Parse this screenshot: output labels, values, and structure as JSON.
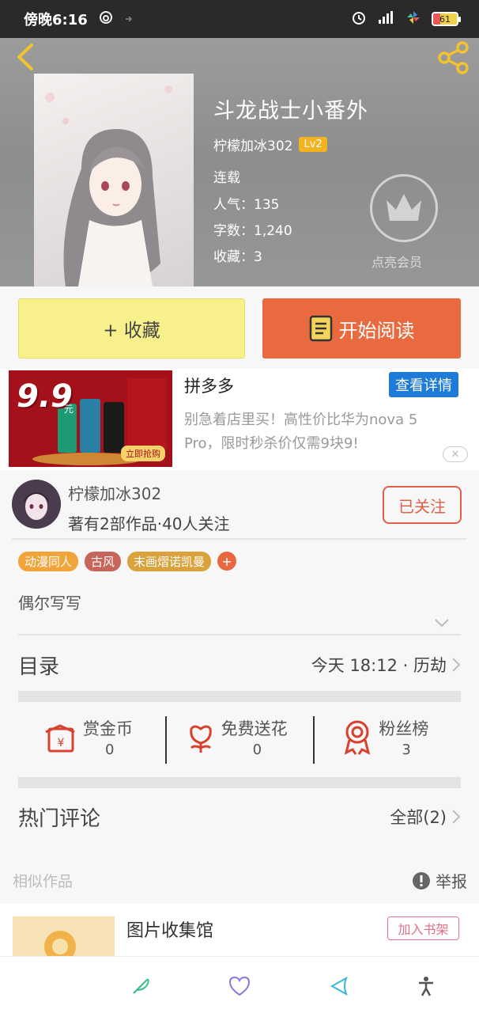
{
  "status_bar": {
    "time": "傍晚6:16",
    "battery": "61"
  },
  "book": {
    "title": "斗龙战士小番外",
    "author": "柠檬加冰302",
    "level": "Lv2",
    "status": "连载",
    "popularity": "人气：135",
    "word_count": "字数：1,240",
    "favorites": "收藏：3",
    "vip_label": "点亮会员"
  },
  "actions": {
    "favorite_label": "+ 收藏",
    "read_label": "开始阅读"
  },
  "ad": {
    "title": "拼多多",
    "detail_label": "查看详情",
    "description": "别急着店里买！高性价比华为nova 5 Pro，限时秒杀价仅需9块9!",
    "price_text": "9.9",
    "price_unit": "元",
    "cta_text": "立即抢购",
    "close_label": "✕"
  },
  "author": {
    "name": "柠檬加冰302",
    "stats": "著有2部作品·40人关注",
    "follow_label": "已关注"
  },
  "tags": [
    {
      "label": "动漫同人",
      "color": "#f0a43a"
    },
    {
      "label": "古风",
      "color": "#c7655a"
    },
    {
      "label": "末画熠诺凯曼",
      "color": "#d9a23c"
    }
  ],
  "tag_plus": "+",
  "intro": "偶尔写写",
  "toc": {
    "label": "目录",
    "latest": "今天 18:12 · 历劫"
  },
  "stats": [
    {
      "name": "赏金币",
      "value": "0"
    },
    {
      "name": "免费送花",
      "value": "0"
    },
    {
      "name": "粉丝榜",
      "value": "3"
    }
  ],
  "comments": {
    "label": "热门评论",
    "all_label": "全部(2)"
  },
  "similar": {
    "label": "相似作品",
    "report_label": "举报",
    "item_title": "图片收集馆",
    "add_shelf_label": "加入书架"
  },
  "colors": {
    "accent_orange": "#ea6a3f",
    "fav_yellow": "#f8f08a",
    "ad_blue": "#1e7bd7",
    "icon_red": "#d9412f"
  }
}
